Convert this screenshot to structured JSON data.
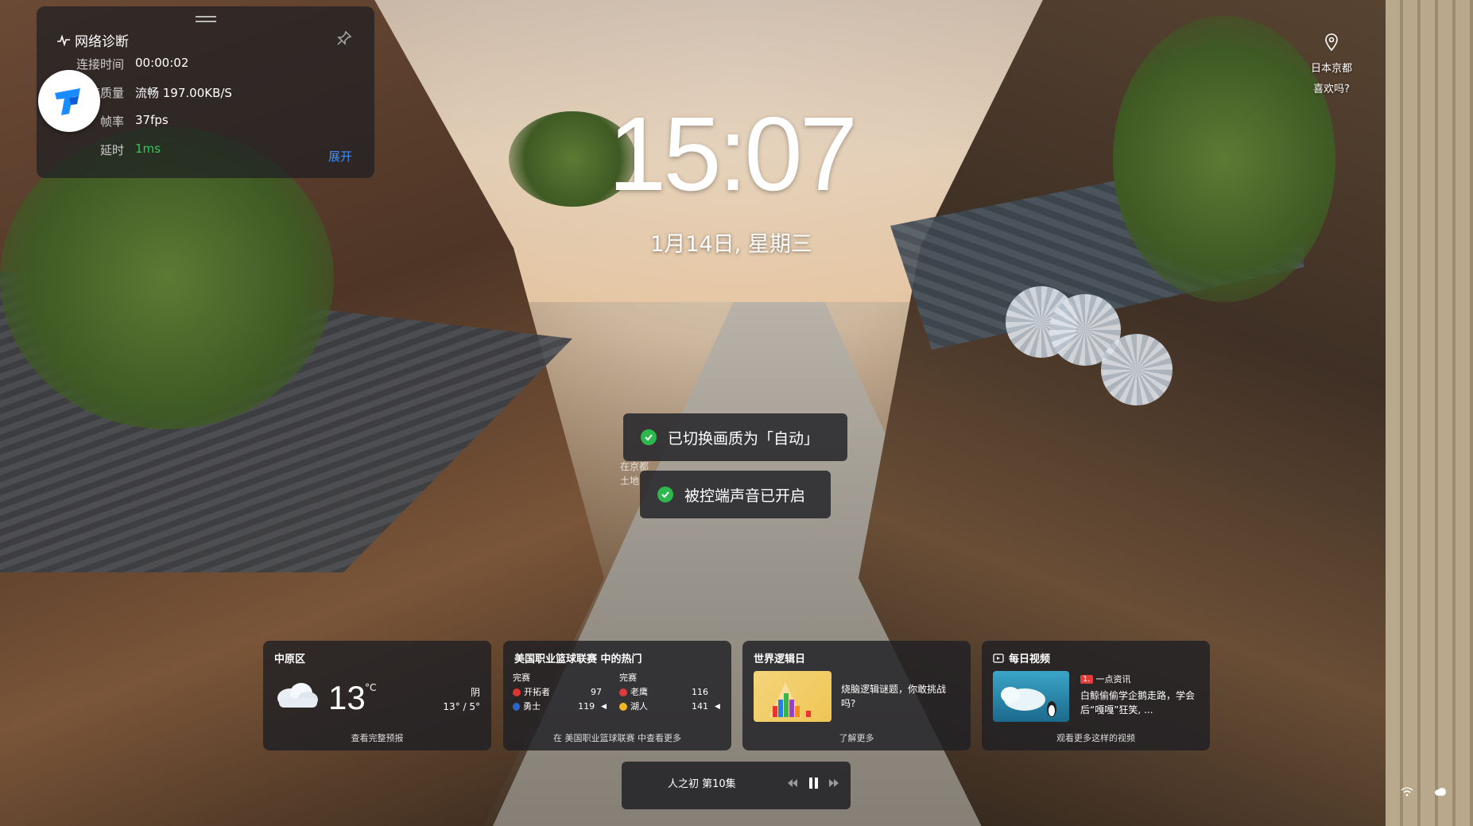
{
  "diagnostics": {
    "title": "网络诊断",
    "rows": [
      {
        "key": "连接时间",
        "value": "00:00:02"
      },
      {
        "key": "连接质量",
        "value": "流畅 197.00KB/S"
      },
      {
        "key": "帧率",
        "value": "37fps"
      },
      {
        "key": "延时",
        "value": "1ms"
      }
    ],
    "expand_label": "展开"
  },
  "clock": {
    "time": "15:07",
    "date": "1月14日, 星期三"
  },
  "location": {
    "place": "日本京都",
    "question": "喜欢吗?"
  },
  "toasts": [
    {
      "text": "已切换画质为「自动」"
    },
    {
      "text": "被控端声音已开启"
    }
  ],
  "faint_caption": [
    "在京都",
    "土地"
  ],
  "cards": {
    "weather": {
      "title": "中原区",
      "temp": "13",
      "unit": "°C",
      "condition": "阴",
      "range": "13° / 5°",
      "footer": "查看完整预报"
    },
    "nba": {
      "title": "美国职业篮球联赛 中的热门",
      "games": [
        {
          "status": "完赛",
          "teams": [
            {
              "name": "开拓者",
              "score": "97",
              "color": "#d33"
            },
            {
              "name": "勇士",
              "score": "119",
              "color": "#2a66c8"
            }
          ]
        },
        {
          "status": "完赛",
          "teams": [
            {
              "name": "老鹰",
              "score": "116",
              "color": "#e03a3e"
            },
            {
              "name": "湖人",
              "score": "141",
              "color": "#f2b524"
            }
          ]
        }
      ],
      "footer": "在 美国职业篮球联赛 中查看更多"
    },
    "world": {
      "title": "世界逻辑日",
      "text": "烧脑逻辑谜题，你敢挑战吗?",
      "footer": "了解更多"
    },
    "video": {
      "title": "每日视频",
      "source": "一点资讯",
      "source_badge": "1.",
      "text": "白鲸偷偷学企鹅走路，学会后“嘎嘎”狂笑, ...",
      "footer": "观看更多这样的视频"
    }
  },
  "player": {
    "title": "人之初 第10集"
  },
  "colors": {
    "accent_link": "#3b8cff",
    "ok_green": "#2db84d",
    "latency_green": "#36c85a"
  }
}
